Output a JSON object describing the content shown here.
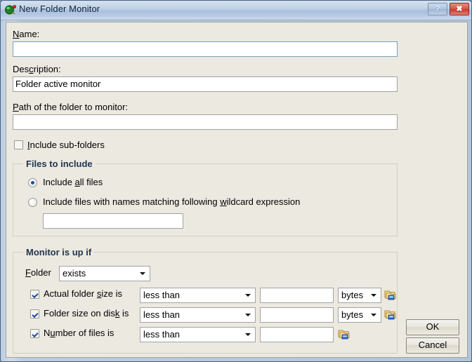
{
  "window": {
    "title": "New Folder Monitor",
    "icon": "monitor-globe-icon",
    "help_label": "?",
    "close_label": "✖",
    "accent_close": "#c23c2e",
    "accent_title": "#b6cae3",
    "body_bg": "#ebe9e0"
  },
  "fields": {
    "name": {
      "label_pre": "",
      "label_accel": "N",
      "label_post": "ame:",
      "value": "",
      "placeholder": ""
    },
    "description": {
      "label_pre": "Des",
      "label_accel": "c",
      "label_post": "ription:",
      "value": "Folder active monitor",
      "placeholder": ""
    },
    "path": {
      "label_pre": "",
      "label_accel": "P",
      "label_post": "ath of the folder to monitor:",
      "value": "",
      "placeholder": ""
    },
    "include_subfolders": {
      "label_pre": "",
      "label_accel": "I",
      "label_post": "nclude sub-folders",
      "checked": false
    }
  },
  "files_group": {
    "title": "Files to include",
    "options": [
      {
        "label_pre": "Include ",
        "label_accel": "a",
        "label_post": "ll files",
        "selected": true
      },
      {
        "label_pre": "Include files with names matching following ",
        "label_accel": "w",
        "label_post": "ildcard expression",
        "selected": false
      }
    ],
    "wildcard_value": "",
    "wildcard_placeholder": ""
  },
  "monitor_group": {
    "title": "Monitor is up if",
    "folder_label_pre": "",
    "folder_label_accel": "F",
    "folder_label_post": "older",
    "folder_condition": "exists",
    "rows": [
      {
        "checked": true,
        "label_pre": "Actual folder ",
        "label_accel": "s",
        "label_post": "ize is",
        "operator": "less than",
        "value": "",
        "unit": "bytes",
        "has_unit": true,
        "browse_icon": "browse-folder-icon"
      },
      {
        "checked": true,
        "label_pre": "Folder size on dis",
        "label_accel": "k",
        "label_post": " is",
        "operator": "less than",
        "value": "",
        "unit": "bytes",
        "has_unit": true,
        "browse_icon": "browse-folder-icon"
      },
      {
        "checked": true,
        "label_pre": "N",
        "label_accel": "u",
        "label_post": "mber of files is",
        "operator": "less than",
        "value": "",
        "unit": "",
        "has_unit": false,
        "browse_icon": "browse-folder-icon"
      }
    ]
  },
  "buttons": {
    "ok": "OK",
    "cancel": "Cancel"
  }
}
